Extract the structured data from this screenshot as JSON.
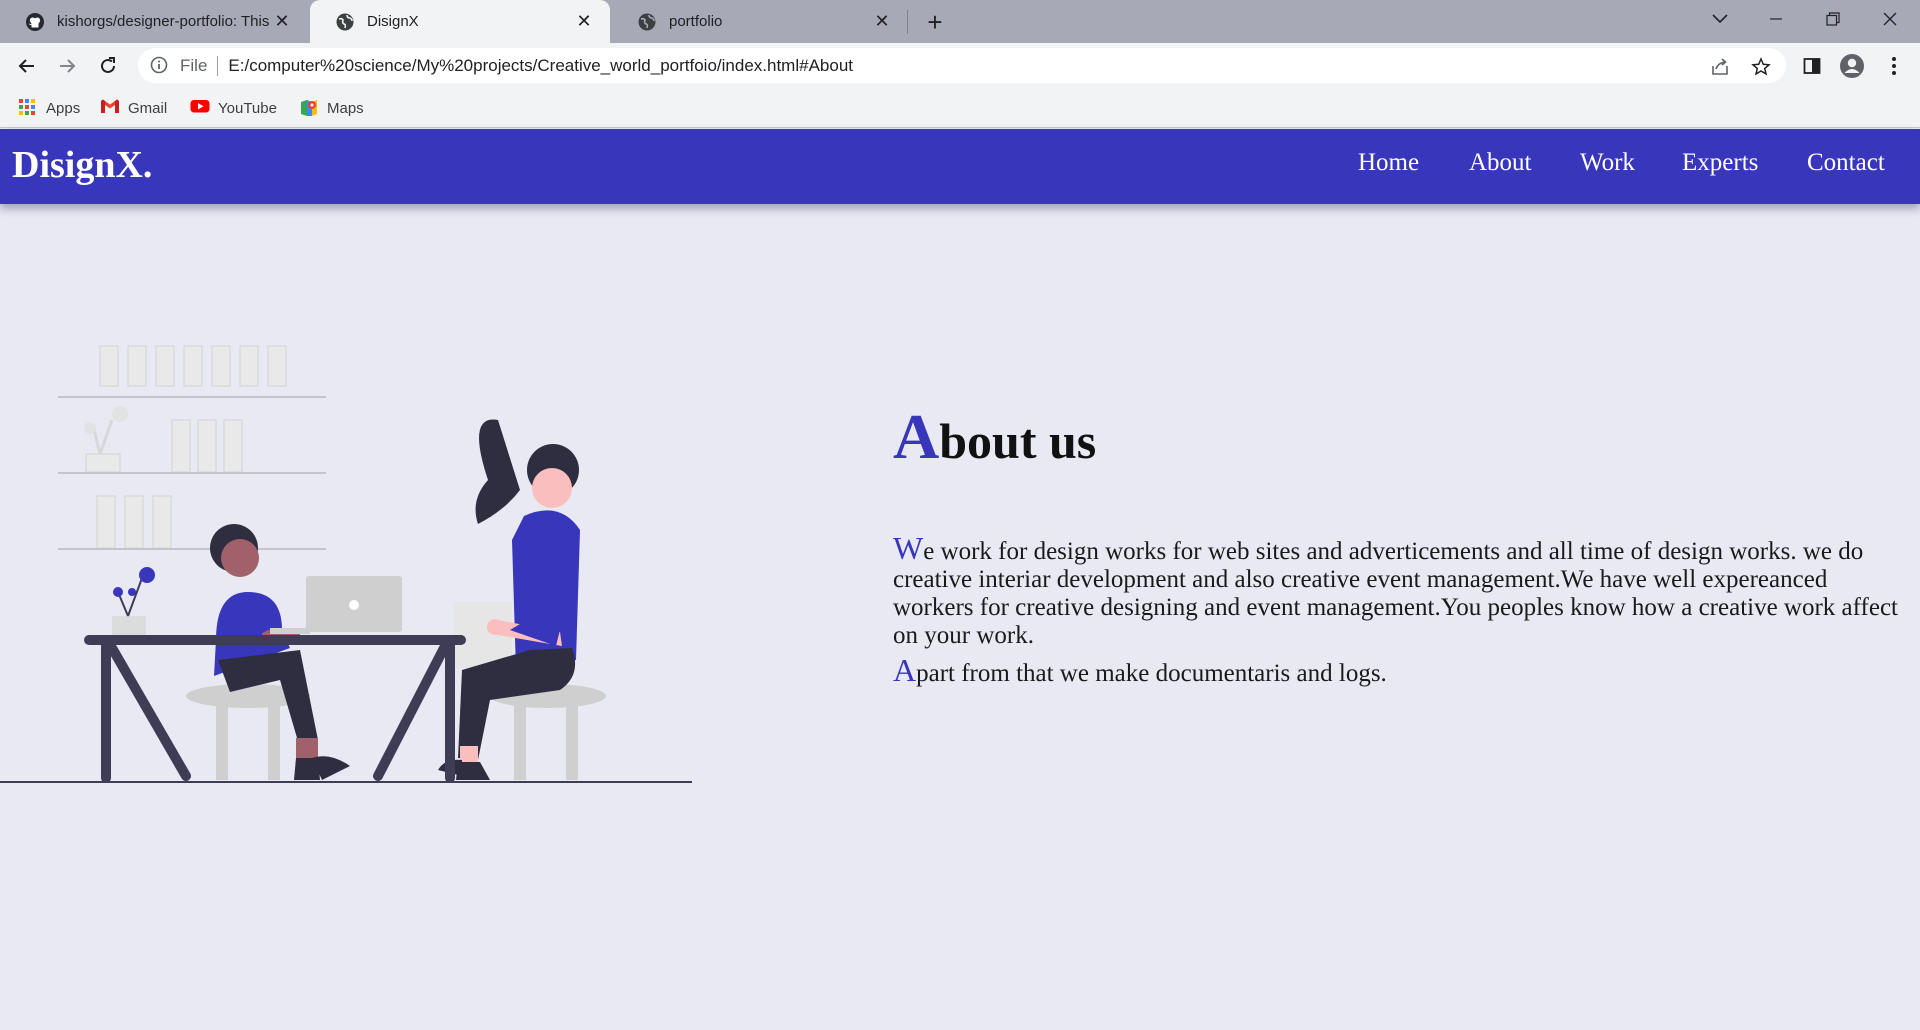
{
  "browser": {
    "tabs": [
      {
        "title": "kishorgs/designer-portfolio: This",
        "favicon": "github-icon",
        "active": false
      },
      {
        "title": "DisignX",
        "favicon": "globe-icon",
        "active": true
      },
      {
        "title": "portfolio",
        "favicon": "globe-icon",
        "active": false
      }
    ],
    "omnibox": {
      "scheme_label": "File",
      "url": "E:/computer%20science/My%20projects/Creative_world_portfoio/index.html#About"
    },
    "bookmarks": [
      {
        "label": "Apps",
        "icon": "apps-grid-icon"
      },
      {
        "label": "Gmail",
        "icon": "gmail-icon"
      },
      {
        "label": "YouTube",
        "icon": "youtube-icon"
      },
      {
        "label": "Maps",
        "icon": "maps-icon"
      }
    ]
  },
  "site": {
    "logo": "DisignX.",
    "nav": [
      "Home",
      "About",
      "Work",
      "Experts",
      "Contact"
    ],
    "colors": {
      "primary": "#3836bb",
      "background": "#e8e9f3"
    },
    "about": {
      "heading_first": "A",
      "heading_rest": "bout us",
      "p1_first": "W",
      "p1_rest": "e work for design works for web sites and adverticements and all time of design works. we do creative interiar development and also creative event management.We have well expereanced workers for creative designing and event management.You peoples know how a creative work affect on your work.",
      "p2_first": "A",
      "p2_rest": "part from that we make documentaris and logs."
    }
  }
}
